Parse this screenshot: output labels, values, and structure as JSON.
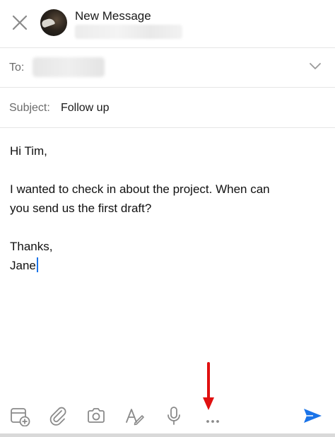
{
  "header": {
    "title": "New Message",
    "close_icon": "close-icon",
    "avatar": "avatar",
    "sender_redacted": true
  },
  "recipients": {
    "to_label": "To:",
    "to_value_redacted": true,
    "expand_icon": "chevron-down-icon"
  },
  "subject": {
    "label": "Subject:",
    "value": "Follow up"
  },
  "body": {
    "greeting": "Hi Tim,",
    "paragraph_line1": "I wanted to check in about the project. When can",
    "paragraph_line2": "you send us the first draft?",
    "closing": "Thanks,",
    "signature": "Jane"
  },
  "toolbar": {
    "items": [
      {
        "icon": "calendar-add-icon"
      },
      {
        "icon": "attachment-icon"
      },
      {
        "icon": "camera-icon"
      },
      {
        "icon": "format-text-icon"
      },
      {
        "icon": "microphone-icon"
      },
      {
        "icon": "more-icon"
      }
    ],
    "send_icon": "send-icon"
  },
  "colors": {
    "accent": "#1a73e8",
    "annotation": "#e01010",
    "label_gray": "#6b6b6b",
    "icon_gray": "#8a8a8a"
  }
}
